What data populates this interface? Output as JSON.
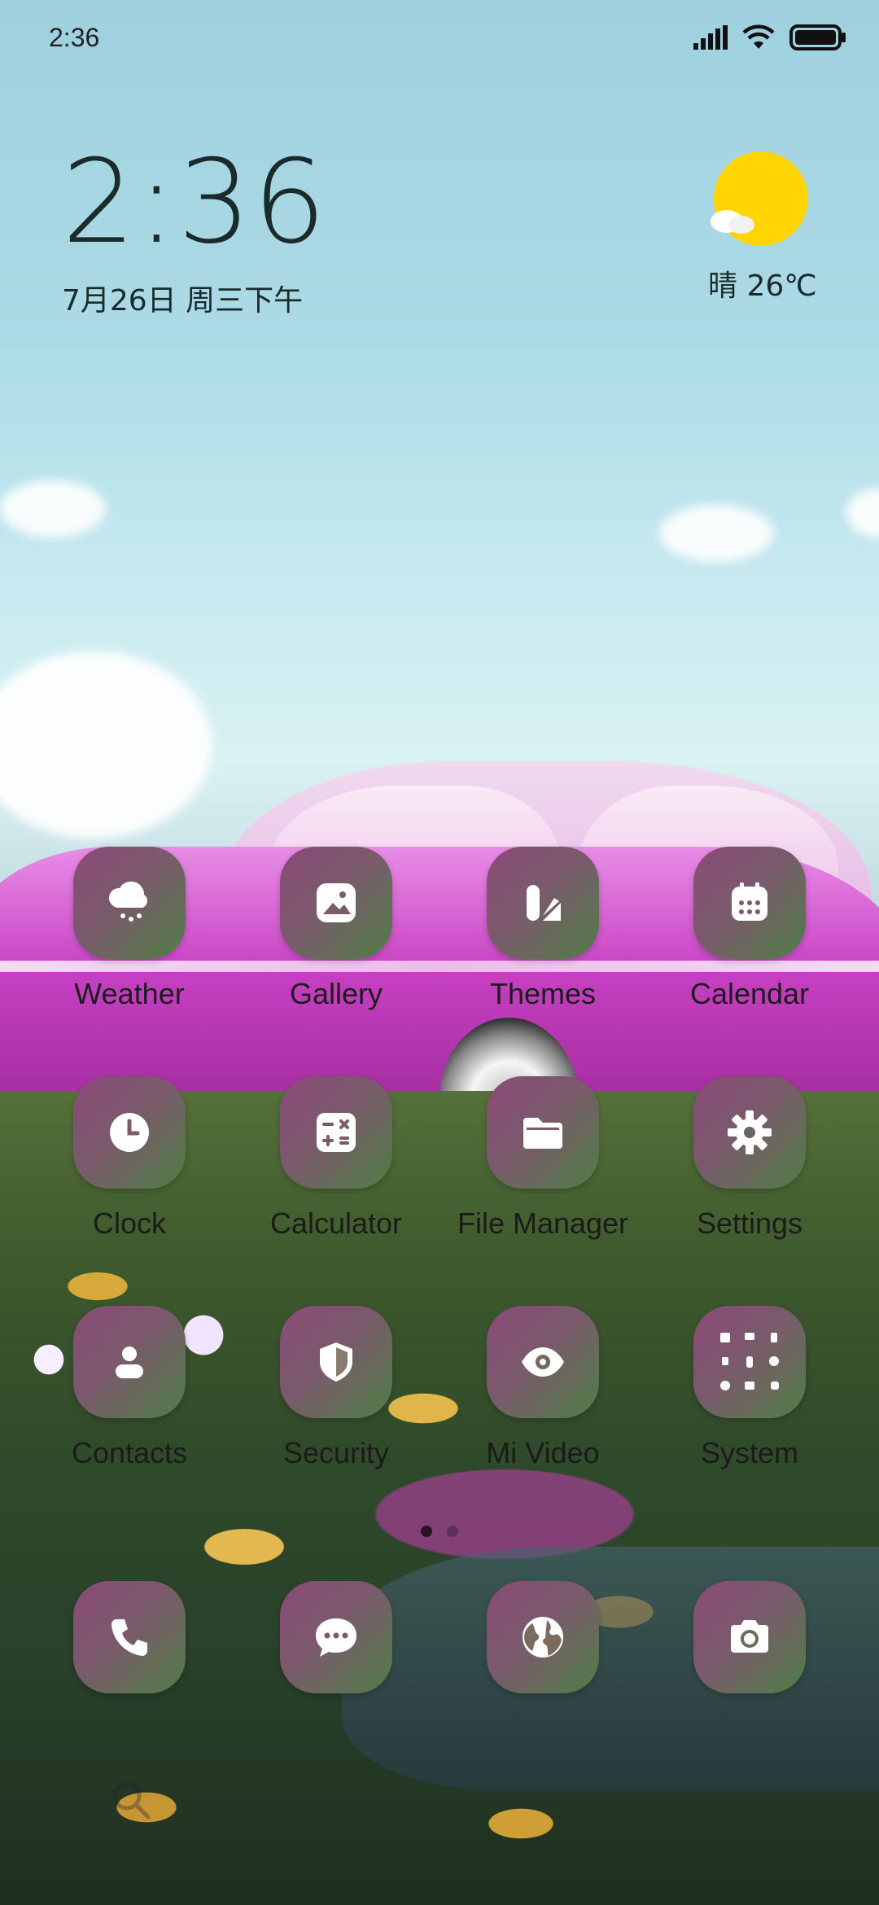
{
  "status_bar": {
    "time": "2:36"
  },
  "clock_widget": {
    "time": "2:36",
    "date": "7月26日 周三下午"
  },
  "weather_widget": {
    "text": "晴 26℃",
    "icon": "sunny-partly-cloudy-icon"
  },
  "apps": [
    {
      "label": "Weather",
      "icon": "weather-icon"
    },
    {
      "label": "Gallery",
      "icon": "gallery-icon"
    },
    {
      "label": "Themes",
      "icon": "themes-icon"
    },
    {
      "label": "Calendar",
      "icon": "calendar-icon"
    },
    {
      "label": "Clock",
      "icon": "clock-icon"
    },
    {
      "label": "Calculator",
      "icon": "calculator-icon"
    },
    {
      "label": "File Manager",
      "icon": "folder-icon"
    },
    {
      "label": "Settings",
      "icon": "gear-icon"
    },
    {
      "label": "Contacts",
      "icon": "contacts-icon"
    },
    {
      "label": "Security",
      "icon": "shield-icon"
    },
    {
      "label": "Mi Video",
      "icon": "eye-icon"
    },
    {
      "label": "System",
      "icon": "folder-grid-icon"
    }
  ],
  "dock": [
    {
      "icon": "phone-icon"
    },
    {
      "icon": "messages-icon"
    },
    {
      "icon": "browser-icon"
    },
    {
      "icon": "camera-icon"
    }
  ],
  "page_indicator": {
    "pages": 2,
    "active": 1
  },
  "colors": {
    "icon_gradient_start": "#8b4a78",
    "icon_gradient_end": "#4f7e44",
    "sun": "#ffd400"
  }
}
